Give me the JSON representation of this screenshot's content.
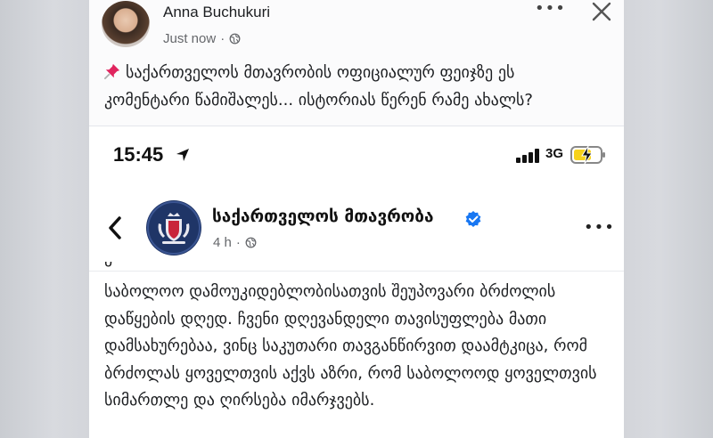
{
  "post": {
    "author": "Anna Buchukuri",
    "time": "Just now",
    "separator": "·",
    "text": "საქართველოს მთავრობის ოფიციალურ ფეიჯზე ეს კომენტარი წამიშალეს... ისტორიას წერენ რამე ახალს?"
  },
  "screenshot": {
    "status": {
      "time": "15:45",
      "network": "3G"
    },
    "page": {
      "name": "საქართველოს მთავრობა",
      "time": "4 h",
      "separator": "·"
    },
    "cut_line": "პ                          ",
    "body": "საბოლოო დამოუკიდებლობისათვის შეუპოვარი ბრძოლის დაწყების დღედ. ჩვენი დღევანდელი თავისუფლება მათი დამსახურებაა, ვინც საკუთარი თავგანწირვით დაამტკიცა, რომ ბრძოლას ყოველთვის აქვს აზრი, რომ საბოლოოდ ყოველთვის სიმართლე და ღირსება იმარჯვებს."
  },
  "icons": {
    "pin": "pushpin-icon",
    "globe": "globe-icon",
    "more": "more-horizontal-icon",
    "close": "close-icon",
    "location": "location-arrow-icon",
    "signal": "cellular-signal-icon",
    "battery": "battery-charging-icon",
    "back": "chevron-left-icon",
    "verified": "verified-badge-icon"
  },
  "colors": {
    "accent": "#1877f2",
    "battery": "#f7d21b",
    "pin": "#e0245e"
  }
}
